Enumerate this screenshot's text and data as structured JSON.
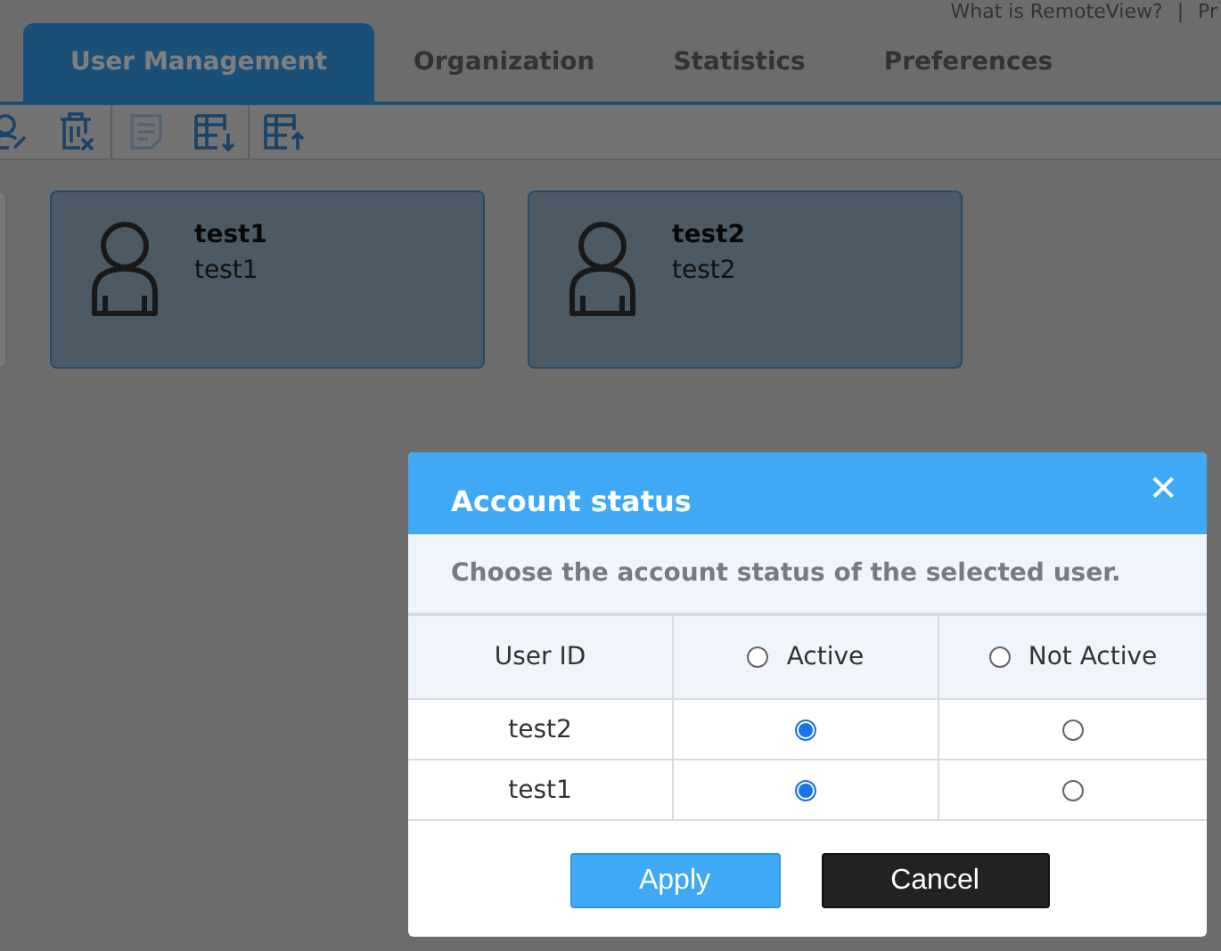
{
  "top_links": [
    "What is RemoteView?",
    "|",
    "Pr"
  ],
  "tabs": [
    {
      "label": "User Management",
      "selected": true
    },
    {
      "label": "Organization",
      "selected": false
    },
    {
      "label": "Statistics",
      "selected": false
    },
    {
      "label": "Preferences",
      "selected": false
    }
  ],
  "toolbar": [
    {
      "kind": "user-edit",
      "disabled": false
    },
    {
      "kind": "delete",
      "disabled": false
    },
    {
      "kind": "note",
      "disabled": true
    },
    {
      "kind": "export",
      "disabled": false
    },
    {
      "kind": "import",
      "disabled": false
    }
  ],
  "users": [
    {
      "name": "test1",
      "id": "test1"
    },
    {
      "name": "test2",
      "id": "test2"
    }
  ],
  "dialog": {
    "title": "Account status",
    "close": "✕",
    "description": "Choose the account status of the selected user.",
    "columns": [
      {
        "label": "User ID"
      },
      {
        "label": "Active",
        "selected": false
      },
      {
        "label": "Not Active",
        "selected": false
      }
    ],
    "rows": [
      {
        "user_id": "test2",
        "options": [
          {
            "selected": true
          },
          {
            "selected": false
          }
        ]
      },
      {
        "user_id": "test1",
        "options": [
          {
            "selected": true
          },
          {
            "selected": false
          }
        ]
      }
    ],
    "buttons": [
      {
        "label": "Apply",
        "kind": "primary"
      },
      {
        "label": "Cancel",
        "kind": "dark"
      }
    ]
  }
}
